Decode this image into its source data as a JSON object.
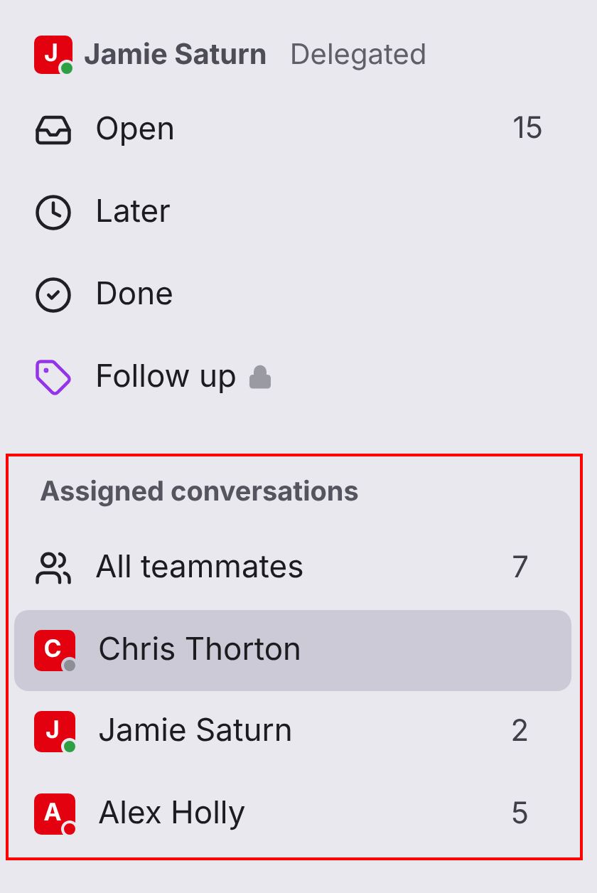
{
  "account": {
    "initial": "J",
    "color": "#2ea043",
    "name": "Jamie Saturn",
    "role": "Delegated"
  },
  "nav": [
    {
      "label": "Open",
      "count": "15",
      "locked": false
    },
    {
      "label": "Later",
      "locked": false
    },
    {
      "label": "Done",
      "locked": false
    },
    {
      "label": "Follow up",
      "locked": true
    }
  ],
  "assigned": {
    "highlighted": true,
    "heading": "Assigned conversations",
    "items": [
      {
        "kind": "group",
        "label": "All teammates",
        "count": "7",
        "selected": false
      },
      {
        "kind": "person",
        "initial": "C",
        "color": "#8e8e96",
        "label": "Chris Thorton",
        "selected": true
      },
      {
        "kind": "person",
        "initial": "J",
        "color": "#2ea043",
        "label": "Jamie Saturn",
        "count": "2",
        "selected": false
      },
      {
        "kind": "person",
        "initial": "A",
        "color": "#e3000f",
        "label": "Alex Holly",
        "count": "5",
        "selected": false
      }
    ]
  }
}
